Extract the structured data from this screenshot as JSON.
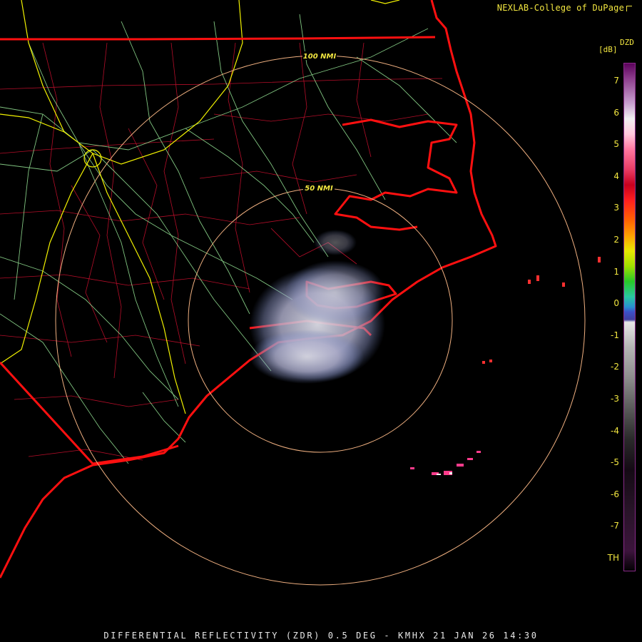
{
  "credit": "NEXLAB-College of DuPage",
  "footer": "DIFFERENTIAL REFLECTIVITY (ZDR) 0.5 DEG - KMHX 21 JAN 26 14:30",
  "legend": {
    "product": "DZD",
    "units": "[dB]",
    "ticks": [
      "7",
      "6",
      "5",
      "4",
      "3",
      "2",
      "1",
      "0",
      "-1",
      "-2",
      "-3",
      "-4",
      "-5",
      "-6",
      "-7",
      "TH"
    ]
  },
  "range_rings": {
    "inner": "50 NMI",
    "outer": "100 NMI"
  },
  "colors": {
    "county_lines": "#c8102e",
    "state_lines": "#ff1010",
    "highways_major": "#f2f200",
    "highways_minor": "#98e898",
    "range_rings": "#f0b080",
    "legend_text": "#f2e640"
  },
  "icons": {
    "credit_logo": "corner-icon"
  }
}
